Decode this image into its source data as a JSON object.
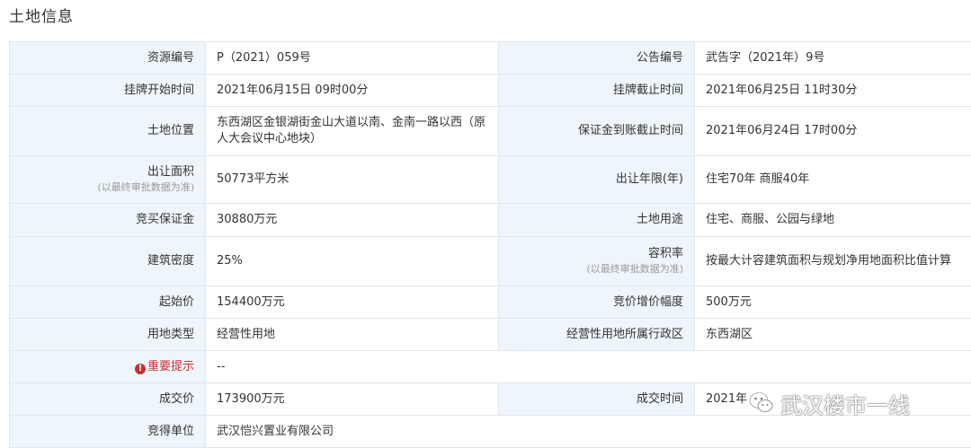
{
  "page": {
    "title": "土地信息"
  },
  "rows": [
    {
      "k1": "资源编号",
      "v1": "P（2021）059号",
      "k2": "公告编号",
      "v2": "武告字（2021年）9号"
    },
    {
      "k1": "挂牌开始时间",
      "v1": "2021年06月15日 09时00分",
      "k2": "挂牌截止时间",
      "v2": "2021年06月25日 11时30分"
    },
    {
      "k1": "土地位置",
      "v1": "东西湖区金银湖街金山大道以南、金南一路以西（原人大会议中心地块）",
      "k2": "保证金到账截止时间",
      "v2": "2021年06月24日 17时00分"
    },
    {
      "k1": "出让面积",
      "k1_note": "(以最终审批数据为准)",
      "v1": "50773平方米",
      "k2": "出让年限(年)",
      "v2": "住宅70年 商服40年"
    },
    {
      "k1": "竞买保证金",
      "v1": "30880万元",
      "k2": "土地用途",
      "v2": "住宅、商服、公园与绿地"
    },
    {
      "k1": "建筑密度",
      "v1": "25%",
      "k2": "容积率",
      "k2_note": "(以最终审批数据为准)",
      "v2": "按最大计容建筑面积与规划净用地面积比值计算"
    },
    {
      "k1": "起始价",
      "v1": "154400万元",
      "k2": "竞价增价幅度",
      "v2": "500万元"
    },
    {
      "k1": "用地类型",
      "v1": "经营性用地",
      "k2": "经营性用地所属行政区",
      "v2": "东西湖区"
    },
    {
      "k1": "重要提示",
      "v1": "--"
    },
    {
      "k1": "成交价",
      "v1": "173900万元",
      "k2": "成交时间",
      "v2": "2021年"
    },
    {
      "k1": "竞得单位",
      "v1": "武汉恺兴置业有限公司"
    }
  ],
  "watermark": {
    "text": "武汉楼市一线",
    "icon": "wechat-icon"
  },
  "colors": {
    "label_bg": "#eef6fb",
    "border": "#dfe6ec",
    "warning": "#c62f2f"
  }
}
